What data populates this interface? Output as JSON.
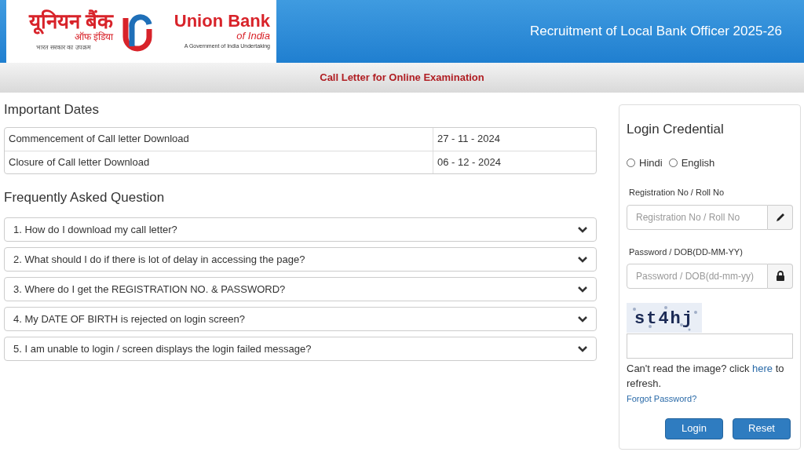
{
  "header": {
    "logo": {
      "hindi_name": "यूनियन बैंक",
      "hindi_sub": "ऑफ इंडिया",
      "hindi_tagline": "भारत सरकार का उपक्रम",
      "english_name": "Union Bank",
      "english_sub": "of India",
      "english_tagline": "A Government of India Undertaking"
    },
    "title": "Recruitment of Local Bank Officer 2025-26"
  },
  "subheader": "Call Letter for Online Examination",
  "important_dates": {
    "heading": "Important Dates",
    "rows": [
      {
        "label": "Commencement of Call letter Download",
        "date": "27 - 11 - 2024"
      },
      {
        "label": "Closure of Call letter Download",
        "date": "06 - 12 - 2024"
      }
    ]
  },
  "faq": {
    "heading": "Frequently Asked Question",
    "items": [
      {
        "question": "1. How do I download my call letter?",
        "expanded": false
      },
      {
        "question": "2. What should I do if there is lot of delay in accessing the page?",
        "expanded": false
      },
      {
        "question": "3. Where do I get the REGISTRATION NO. & PASSWORD?",
        "expanded": false
      },
      {
        "question": "4. My DATE OF BIRTH is rejected on login screen?",
        "expanded": false
      },
      {
        "question": "5. I am unable to login / screen displays the login failed message?",
        "expanded": false
      }
    ]
  },
  "login": {
    "heading": "Login Credential",
    "languages": [
      {
        "label": "Hindi",
        "selected": false
      },
      {
        "label": "English",
        "selected": false
      }
    ],
    "fields": [
      {
        "label": "Registration No / Roll No",
        "placeholder": "Registration No / Roll No",
        "kind": "pencil"
      },
      {
        "label": "Password / DOB(DD-MM-YY)",
        "placeholder": "Password / DOB(dd-mm-yy)",
        "kind": "lock"
      }
    ],
    "captcha": "st4hj",
    "captcha_help": {
      "before": "Can't read the image? click",
      "link": "here",
      "after": "to refresh."
    },
    "forgot": "Forgot Password?",
    "buttons": [
      "Login",
      "Reset"
    ]
  }
}
